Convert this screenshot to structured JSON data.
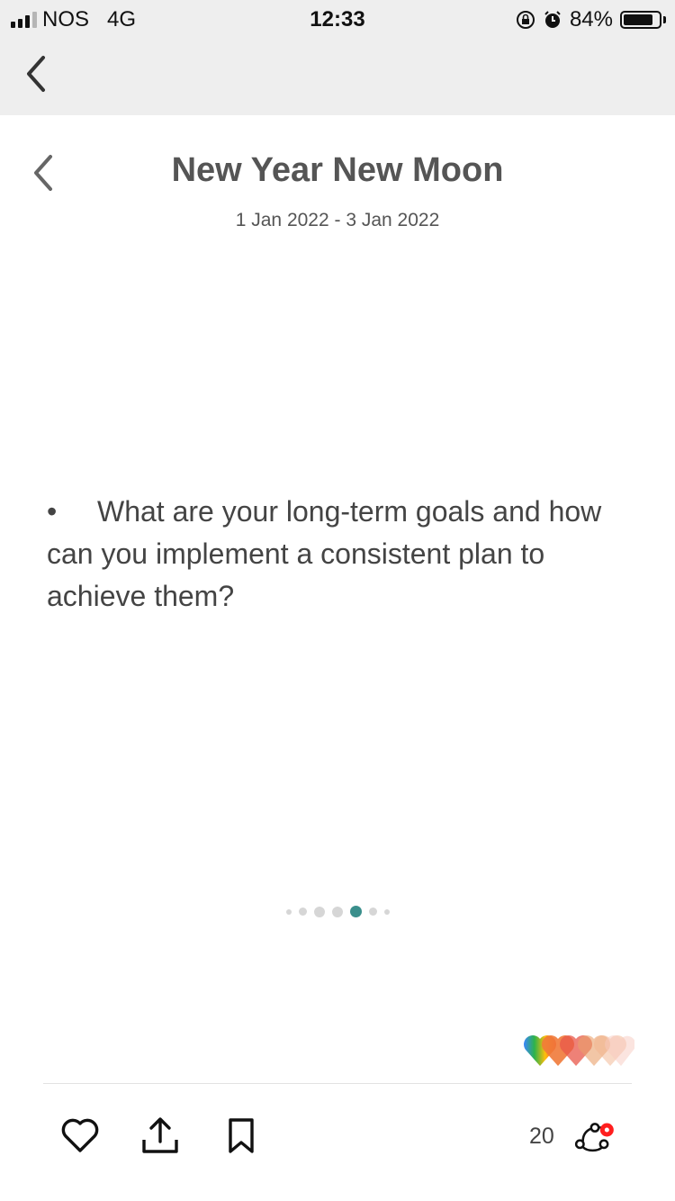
{
  "status_bar": {
    "carrier": "NOS",
    "network": "4G",
    "time": "12:33",
    "battery": "84%",
    "battery_level": 0.84,
    "icons": [
      "signal-icon",
      "rotation-lock-icon",
      "alarm-icon",
      "battery-icon"
    ]
  },
  "nav": {
    "back_icon": "chevron-left-icon"
  },
  "header": {
    "title": "New Year New Moon",
    "date_range": "1 Jan 2022 - 3 Jan 2022"
  },
  "content": {
    "bullet": "•",
    "question": "What are your long-term goals and how can you implement a consistent plan to achieve them?"
  },
  "pager": {
    "total": 7,
    "active_index": 4
  },
  "reactions": {
    "icon": "rainbow-hearts-icon"
  },
  "actions": {
    "count": "20",
    "icons": [
      "heart-icon",
      "share-icon",
      "bookmark-icon",
      "connections-icon"
    ]
  },
  "colors": {
    "accent": "#3a8f8c",
    "text": "#555555",
    "bar_background": "#eeeeee",
    "notification": "#ff1e1e"
  }
}
